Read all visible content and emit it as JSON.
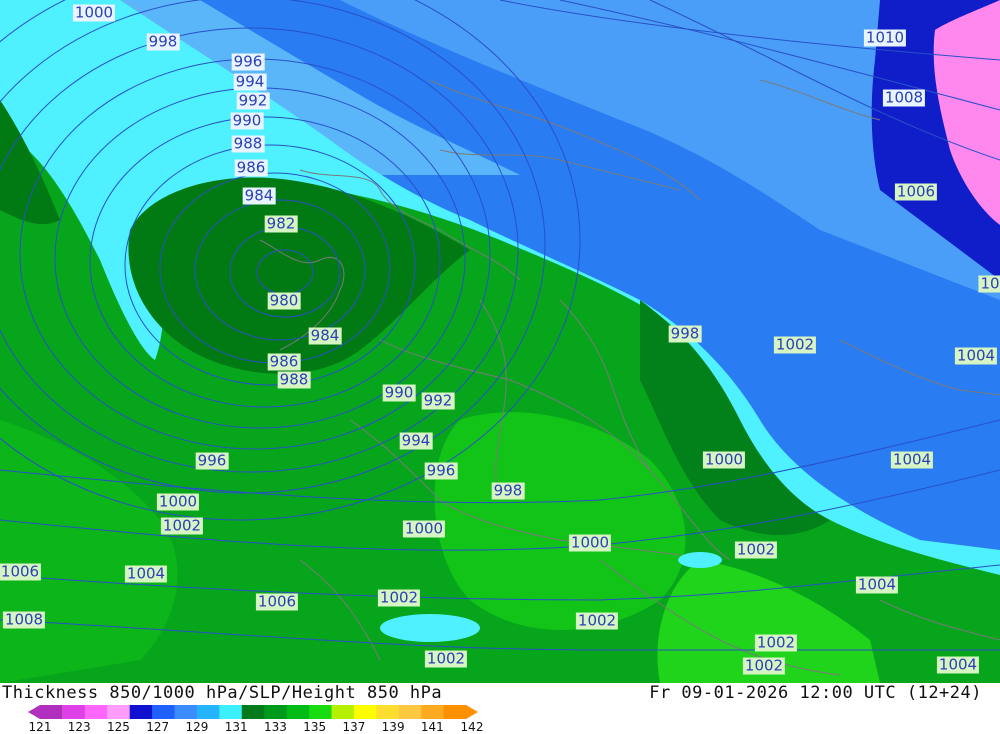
{
  "title_left": "Thickness 850/1000 hPa/SLP/Height 850 hPa",
  "title_right": "Fr 09-01-2026 12:00 UTC (12+24)",
  "colorbar": {
    "ticks": [
      "121",
      "123",
      "125",
      "127",
      "129",
      "131",
      "133",
      "135",
      "137",
      "139",
      "141",
      "142"
    ],
    "colors": [
      "#b02fbf",
      "#e040e8",
      "#ff66ff",
      "#ff9cff",
      "#1010d0",
      "#2060ff",
      "#3a8cff",
      "#26b4ff",
      "#3cf0ff",
      "#007a1a",
      "#009a1a",
      "#00bb15",
      "#16dc10",
      "#b4f000",
      "#ffff00",
      "#ffde30",
      "#ffc840",
      "#ffaa20",
      "#ff9000"
    ]
  },
  "isobar_labels": [
    {
      "text": "1000",
      "bg": "blue"
    },
    {
      "text": "998",
      "bg": "blue"
    },
    {
      "text": "996",
      "bg": "blue"
    },
    {
      "text": "994",
      "bg": "blue"
    },
    {
      "text": "992",
      "bg": "blue"
    },
    {
      "text": "990",
      "bg": "blue"
    },
    {
      "text": "988",
      "bg": "blue"
    },
    {
      "text": "986",
      "bg": "blue"
    },
    {
      "text": "984",
      "bg": "blue"
    },
    {
      "text": "982",
      "bg": "green"
    },
    {
      "text": "980",
      "bg": "green"
    },
    {
      "text": "984",
      "bg": "green"
    },
    {
      "text": "986",
      "bg": "green"
    },
    {
      "text": "988",
      "bg": "green"
    },
    {
      "text": "990",
      "bg": "green"
    },
    {
      "text": "992",
      "bg": "green"
    },
    {
      "text": "994",
      "bg": "green"
    },
    {
      "text": "996",
      "bg": "green"
    },
    {
      "text": "996",
      "bg": "green"
    },
    {
      "text": "998",
      "bg": "green"
    },
    {
      "text": "998",
      "bg": "green"
    },
    {
      "text": "1000",
      "bg": "green"
    },
    {
      "text": "1000",
      "bg": "green"
    },
    {
      "text": "1000",
      "bg": "green"
    },
    {
      "text": "1000",
      "bg": "green"
    },
    {
      "text": "1002",
      "bg": "green"
    },
    {
      "text": "1002",
      "bg": "green"
    },
    {
      "text": "1002",
      "bg": "green"
    },
    {
      "text": "1002",
      "bg": "green"
    },
    {
      "text": "1002",
      "bg": "green"
    },
    {
      "text": "1002",
      "bg": "green"
    },
    {
      "text": "1002",
      "bg": "green"
    },
    {
      "text": "1002",
      "bg": "green"
    },
    {
      "text": "1004",
      "bg": "green"
    },
    {
      "text": "1004",
      "bg": "green"
    },
    {
      "text": "1004",
      "bg": "green"
    },
    {
      "text": "1004",
      "bg": "green"
    },
    {
      "text": "1004",
      "bg": "green"
    },
    {
      "text": "1006",
      "bg": "green"
    },
    {
      "text": "1006",
      "bg": "green"
    },
    {
      "text": "1006",
      "bg": "green"
    },
    {
      "text": "1008",
      "bg": "green"
    },
    {
      "text": "1008",
      "bg": "blue"
    },
    {
      "text": "1010",
      "bg": "blue"
    },
    {
      "text": "10",
      "bg": "green"
    }
  ]
}
